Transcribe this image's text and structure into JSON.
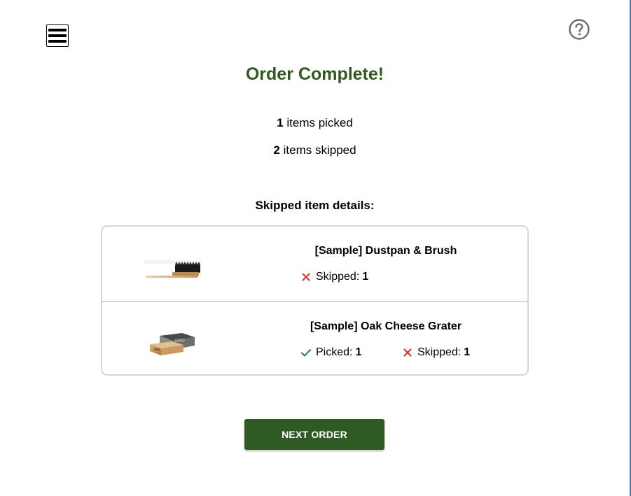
{
  "header": {
    "menu_icon": "hamburger-menu-icon",
    "help_icon": "question-circle-icon"
  },
  "summary": {
    "title": "Order Complete!",
    "picked_count": "1",
    "picked_label": "items picked",
    "skipped_count": "2",
    "skipped_label": "items skipped"
  },
  "details": {
    "heading": "Skipped item details:",
    "items": [
      {
        "name": "[Sample] Dustpan & Brush",
        "image_icon": "dustpan-brush-product-image",
        "skipped_label": "Skipped:",
        "skipped_value": "1"
      },
      {
        "name": "[Sample] Oak Cheese Grater",
        "image_icon": "cheese-grater-product-image",
        "picked_label": "Picked:",
        "picked_value": "1",
        "skipped_label": "Skipped:",
        "skipped_value": "1"
      }
    ]
  },
  "actions": {
    "next_order_label": "NEXT ORDER"
  },
  "colors": {
    "brand_green": "#2f5a24",
    "skipped_red": "#d32f2f",
    "picked_green": "#2e7d32",
    "card_border": "#d6d6d6"
  }
}
